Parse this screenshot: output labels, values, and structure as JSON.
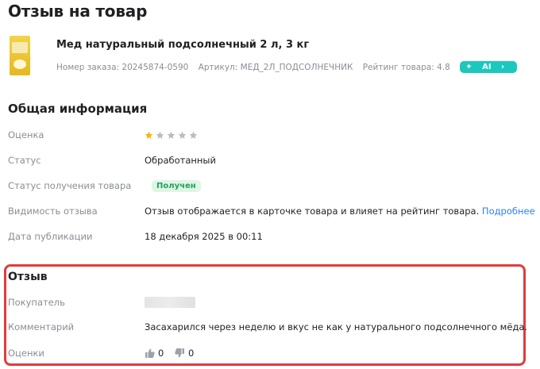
{
  "page": {
    "title": "Отзыв на товар"
  },
  "product": {
    "name": "Мед натуральный подсолнечный 2 л, 3 кг",
    "order": "Номер заказа: 20245874-0590",
    "article": "Артикул: МЕД_2Л_ПОДСОЛНЕЧНИК",
    "rating": "Рейтинг товара: 4.8",
    "ai_label": "AI"
  },
  "general": {
    "title": "Общая информация",
    "rating_label": "Оценка",
    "rating_value": 1,
    "rating_max": 5,
    "status_label": "Статус",
    "status_value": "Обработанный",
    "receipt_label": "Статус получения товара",
    "receipt_value": "Получен",
    "visibility_label": "Видимость отзыва",
    "visibility_value": "Отзыв отображается в карточке товара и влияет на рейтинг товара.",
    "visibility_link": "Подробнее",
    "date_label": "Дата публикации",
    "date_value": "18 декабря 2025 в 00:11"
  },
  "review": {
    "title": "Отзыв",
    "buyer_label": "Покупатель",
    "comment_label": "Комментарий",
    "comment_value": "Засахарился через неделю и вкус не как у натурального подсолнечного мёда.",
    "votes_label": "Оценки",
    "likes": "0",
    "dislikes": "0"
  },
  "colors": {
    "star_active": "#f5b800",
    "star_inactive": "#b9bcc3",
    "highlight": "#e23b3b",
    "link": "#2f7df6",
    "ai": "#1cc8be"
  }
}
